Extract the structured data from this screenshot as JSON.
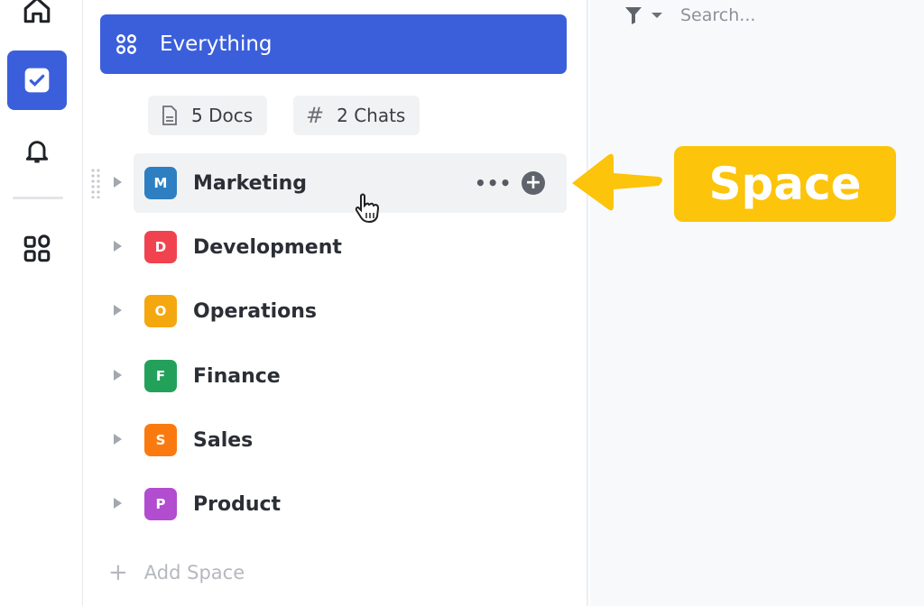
{
  "rail": {
    "items": [
      {
        "icon": "home-icon"
      },
      {
        "icon": "checkbox-icon",
        "active": true
      },
      {
        "icon": "bell-icon"
      },
      {
        "icon": "apps-grid-icon"
      }
    ]
  },
  "sidebar": {
    "everything_label": "Everything",
    "chips": [
      {
        "label": "5 Docs",
        "icon": "document-icon"
      },
      {
        "label": "2 Chats",
        "icon": "#"
      }
    ],
    "spaces": [
      {
        "letter": "M",
        "name": "Marketing",
        "color": "#2d7fc1",
        "hovered": true
      },
      {
        "letter": "D",
        "name": "Development",
        "color": "#f0434f"
      },
      {
        "letter": "O",
        "name": "Operations",
        "color": "#f5a70f"
      },
      {
        "letter": "F",
        "name": "Finance",
        "color": "#23a15a"
      },
      {
        "letter": "S",
        "name": "Sales",
        "color": "#fb7a10"
      },
      {
        "letter": "P",
        "name": "Product",
        "color": "#b24dcf"
      }
    ],
    "more_label": "•••",
    "plus_label": "+",
    "add_space_label": "Add Space",
    "add_space_icon": "+"
  },
  "main": {
    "search_placeholder": "Search..."
  },
  "callout": {
    "label": "Space",
    "color": "#fcc40a"
  },
  "accent": "#3b5fdb"
}
